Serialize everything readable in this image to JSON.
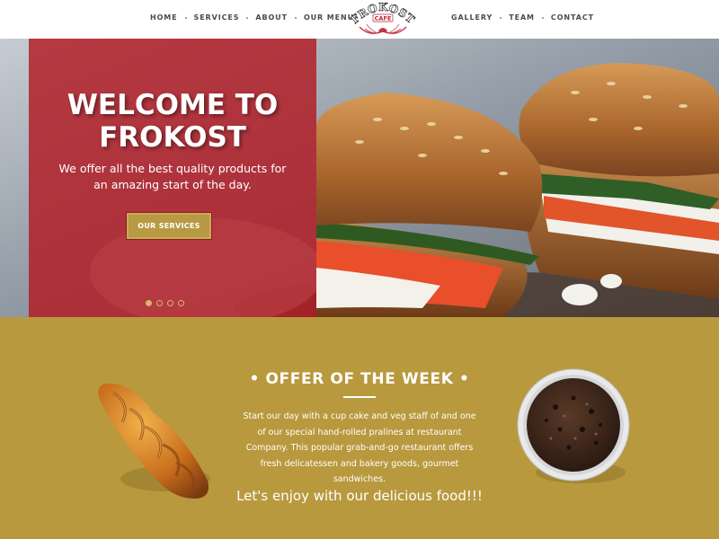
{
  "nav": {
    "left": [
      "HOME",
      "SERVICES",
      "ABOUT",
      "OUR MENU"
    ],
    "right": [
      "GALLERY",
      "TEAM",
      "CONTACT"
    ]
  },
  "logo": {
    "name": "FROKOST",
    "sub": "CAFE"
  },
  "hero": {
    "title_line1": "WELCOME TO",
    "title_line2": "FROKOST",
    "subtitle": "We offer all the best quality products for an amazing start of the day.",
    "button_label": "OUR SERVICES",
    "slides": 4,
    "active_slide": 1,
    "colors": {
      "panel": "#b21c24",
      "button": "#b89a44"
    }
  },
  "offer": {
    "title": "• OFFER OF THE WEEK •",
    "body": "Start our day with a cup cake and veg staff of and one of our special hand-rolled pralines at restaurant Company. This popular grab-and-go restaurant offers fresh delicatessen and bakery goods, gourmet sandwiches.",
    "tagline": "Let's enjoy with our delicious food!!!",
    "colors": {
      "background": "#b8993e"
    }
  }
}
